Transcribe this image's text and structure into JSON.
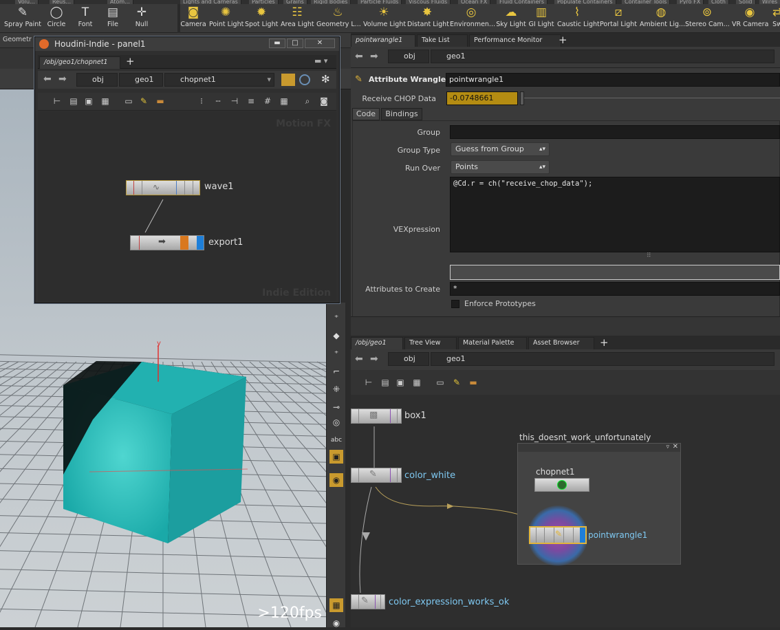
{
  "shelf": {
    "tabs": [
      "Volu...",
      "Reus...",
      "Atom...",
      "Lights and Cameras",
      "Particles",
      "Grains",
      "Rigid Bodies",
      "Particle Fluids",
      "Viscous Fluids",
      "Ocean FX",
      "Fluid Containers",
      "Populate Containers",
      "Container Tools",
      "Pyro FX",
      "Cloth",
      "Solid",
      "Wires"
    ],
    "left_tools": [
      {
        "label": "Spray Paint",
        "icon": "spray-icon"
      },
      {
        "label": "Circle",
        "icon": "circle-icon"
      },
      {
        "label": "Font",
        "icon": "font-icon"
      },
      {
        "label": "File",
        "icon": "file-icon"
      },
      {
        "label": "Null",
        "icon": "null-icon"
      }
    ],
    "right_tools": [
      {
        "label": "Camera",
        "icon": "camera-icon"
      },
      {
        "label": "Point Light",
        "icon": "point-light-icon"
      },
      {
        "label": "Spot Light",
        "icon": "spot-light-icon"
      },
      {
        "label": "Area Light",
        "icon": "area-light-icon"
      },
      {
        "label": "Geometry L...",
        "icon": "geometry-light-icon"
      },
      {
        "label": "Volume Light",
        "icon": "volume-light-icon"
      },
      {
        "label": "Distant Light",
        "icon": "distant-light-icon"
      },
      {
        "label": "Environmen...",
        "icon": "environment-light-icon"
      },
      {
        "label": "Sky Light",
        "icon": "sky-light-icon"
      },
      {
        "label": "GI Light",
        "icon": "gi-light-icon"
      },
      {
        "label": "Caustic Light",
        "icon": "caustic-light-icon"
      },
      {
        "label": "Portal Light",
        "icon": "portal-light-icon"
      },
      {
        "label": "Ambient Lig...",
        "icon": "ambient-light-icon"
      },
      {
        "label": "Stereo Cam...",
        "icon": "stereo-camera-icon"
      },
      {
        "label": "VR Camera",
        "icon": "vr-camera-icon"
      },
      {
        "label": "Sw",
        "icon": "switcher-icon"
      }
    ]
  },
  "left_tab": "Geometr",
  "panel": {
    "title": "Houdini-Indie - panel1",
    "tab": "/obj/geo1/chopnet1",
    "crumbs": [
      "obj",
      "geo1",
      "chopnet1"
    ],
    "watermark_top": "Motion FX",
    "watermark_bottom": "Indie Edition",
    "nodes": [
      "wave1",
      "export1"
    ]
  },
  "viewport": {
    "fps": ">120fps",
    "axis_y": "y"
  },
  "params": {
    "tabs": [
      "pointwrangle1",
      "Take List",
      "Performance Monitor"
    ],
    "crumbs": [
      "obj",
      "geo1"
    ],
    "node_type": "Attribute Wrangle",
    "node_name": "pointwrangle1",
    "receive_label": "Receive CHOP Data",
    "receive_value": "-0.0748661",
    "subtabs": [
      "Code",
      "Bindings"
    ],
    "group_label": "Group",
    "group_value": "",
    "group_type_label": "Group Type",
    "group_type_value": "Guess from Group",
    "run_over_label": "Run Over",
    "run_over_value": "Points",
    "vex_label": "VEXpression",
    "vex_code": "@Cd.r = ch(\"receive_chop_data\");",
    "attrs_label": "Attributes to Create",
    "attrs_value": "*",
    "enforce_label": "Enforce Prototypes"
  },
  "network": {
    "tabs": [
      "/obj/geo1",
      "Tree View",
      "Material Palette",
      "Asset Browser"
    ],
    "crumbs": [
      "obj",
      "geo1"
    ],
    "subnet_title": "this_doesnt_work_unfortunately",
    "nodes": [
      "box1",
      "color_white",
      "chopnet1",
      "pointwrangle1",
      "color_expression_works_ok"
    ]
  }
}
